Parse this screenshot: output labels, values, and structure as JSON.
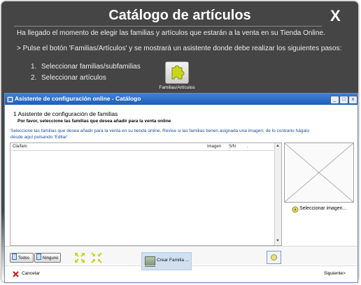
{
  "help_panel": {
    "title": "Catálogo de artículos",
    "close_glyph": "X",
    "intro": "Ha llegado el momento de elegir las familias y artículos que estarán a la venta en su Tienda Online.",
    "instruction": "> Pulse el botón 'Familias/Artículos' y se mostrará un asistente donde debe realizar los siguientes pasos:",
    "steps": [
      "Seleccionar familias/subfamilias",
      "Seleccionar artículos"
    ],
    "step_numbers": [
      "1.",
      "2."
    ],
    "familias_button_label": "Familias/Artículos",
    "familias_button_icon": "puzzle-piece-icon"
  },
  "wizard": {
    "window_title": "Asistente de configuración online - Catálogo",
    "title_controls": [
      "_",
      "□",
      "x"
    ],
    "step_title": "1 Asistente de configuración de familias",
    "step_subtitle": "Por favor, seleccione las familias que desea añadir para la venta online",
    "instructions": "Seleccione las familias que desea añadir para la venta en su tienda online. Revise si las familias tienen asignada una imagen; de lo contrario hágalo desde aquí pulsando 'Editar'",
    "columns": [
      "Cla/fam",
      "Imagen",
      "S/N",
      "."
    ],
    "select_image_label": "Seleccionar imagen...",
    "all_label": "Todos",
    "none_label": "Ninguno",
    "create_family_label": "Crear Familia ...",
    "cancel_label": "Cancelar",
    "next_label": "Siguiente>",
    "accent": "#1e5fb5",
    "instruction_color": "#1a4fa0",
    "icon_green": "#c8d61e"
  }
}
